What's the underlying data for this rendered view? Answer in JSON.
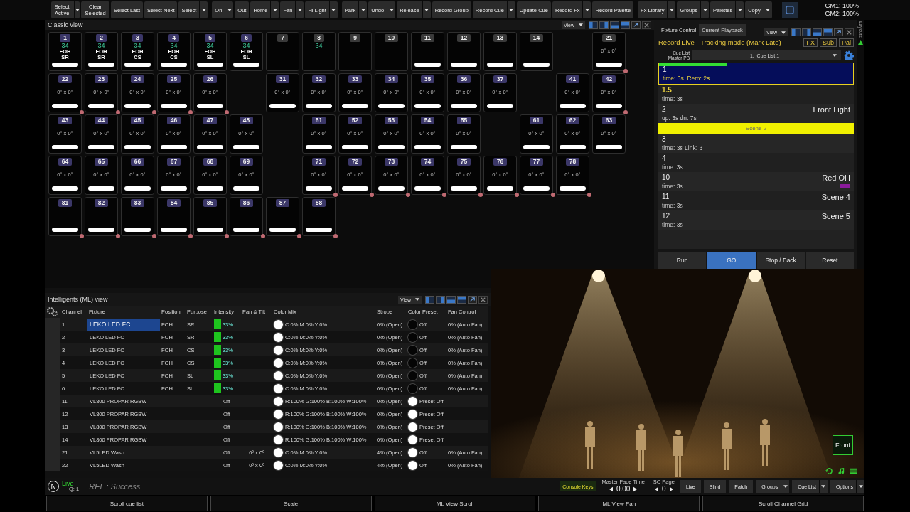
{
  "toolbar": {
    "groups": [
      [
        {
          "label": "Select Active",
          "dropdown": true,
          "wrap": true
        },
        {
          "label": "Clear Selected",
          "dropdown": false,
          "wrap": true
        },
        {
          "label": "Select Last",
          "dropdown": false,
          "wrap": false
        },
        {
          "label": "Select Next",
          "dropdown": false,
          "wrap": false
        },
        {
          "label": "Select",
          "dropdown": true,
          "wrap": false
        }
      ],
      [
        {
          "label": "On",
          "dropdown": true,
          "wrap": false
        },
        {
          "label": "Out",
          "dropdown": false,
          "wrap": false
        },
        {
          "label": "Home",
          "dropdown": true,
          "wrap": false
        },
        {
          "label": "Fan",
          "dropdown": true,
          "wrap": false
        },
        {
          "label": "Hi Light",
          "dropdown": true,
          "wrap": false
        }
      ],
      [
        {
          "label": "Park",
          "dropdown": true,
          "wrap": false
        },
        {
          "label": "Undo",
          "dropdown": true,
          "wrap": false
        },
        {
          "label": "Release",
          "dropdown": true,
          "wrap": false
        },
        {
          "label": "Record Group",
          "dropdown": false,
          "wrap": false
        },
        {
          "label": "Record Cue",
          "dropdown": true,
          "wrap": false
        },
        {
          "label": "Update Cue",
          "dropdown": false,
          "wrap": false
        },
        {
          "label": "Record Fx",
          "dropdown": true,
          "wrap": false
        },
        {
          "label": "Record Palette",
          "dropdown": false,
          "wrap": false
        }
      ],
      [
        {
          "label": "Fx Library",
          "dropdown": true,
          "wrap": false
        },
        {
          "label": "Groups",
          "dropdown": true,
          "wrap": false
        },
        {
          "label": "Palettes",
          "dropdown": true,
          "wrap": false
        },
        {
          "label": "Copy",
          "dropdown": true,
          "wrap": false
        }
      ]
    ],
    "grand_masters": [
      "GM1: 100%",
      "GM2: 100%"
    ]
  },
  "classic_view": {
    "title": "Classic view",
    "view_button": "View",
    "rows": [
      [
        {
          "kind": "channel",
          "number": "1",
          "color": "#3b3768",
          "intensity": "34",
          "position": "FOH",
          "purpose": "SR",
          "bar": true,
          "marked": false
        },
        {
          "kind": "channel",
          "number": "2",
          "color": "#3b3768",
          "intensity": "34",
          "position": "FOH",
          "purpose": "SR",
          "bar": true,
          "marked": false
        },
        {
          "kind": "channel",
          "number": "3",
          "color": "#3b3768",
          "intensity": "34",
          "position": "FOH",
          "purpose": "CS",
          "bar": true,
          "marked": false
        },
        {
          "kind": "channel",
          "number": "4",
          "color": "#3b3768",
          "intensity": "34",
          "position": "FOH",
          "purpose": "CS",
          "bar": true,
          "marked": false
        },
        {
          "kind": "channel",
          "number": "5",
          "color": "#3b3768",
          "intensity": "34",
          "position": "FOH",
          "purpose": "SL",
          "bar": true,
          "marked": false
        },
        {
          "kind": "channel",
          "number": "6",
          "color": "#3b3768",
          "intensity": "34",
          "position": "FOH",
          "purpose": "SL",
          "bar": true,
          "marked": false
        },
        {
          "kind": "channel",
          "number": "7",
          "color": "#3a3a3a",
          "bar": false,
          "marked": false
        },
        {
          "kind": "channel",
          "number": "8",
          "color": "#3a3a3a",
          "intensity": "34",
          "bar": false,
          "marked": false
        },
        {
          "kind": "channel",
          "number": "9",
          "color": "#3a3a3a",
          "bar": false,
          "marked": false
        },
        {
          "kind": "channel",
          "number": "10",
          "color": "#3a3a3a",
          "bar": false,
          "marked": false
        },
        {
          "kind": "channel",
          "number": "11",
          "color": "#3a3a3a",
          "bar": true,
          "marked": false
        },
        {
          "kind": "channel",
          "number": "12",
          "color": "#3a3a3a",
          "bar": true,
          "marked": false
        },
        {
          "kind": "channel",
          "number": "13",
          "color": "#3a3a3a",
          "bar": true,
          "marked": false
        },
        {
          "kind": "channel",
          "number": "14",
          "color": "#3a3a3a",
          "bar": true,
          "marked": false
        },
        {
          "kind": "empty"
        },
        {
          "kind": "channel",
          "number": "21",
          "color": "#3a3a3a",
          "pan_tilt": "0° x 0°",
          "bar": true,
          "marked": true
        }
      ],
      [
        {
          "kind": "channel",
          "number": "22",
          "color": "#3b3768",
          "pan_tilt": "0° x 0°",
          "bar": true,
          "marked": true
        },
        {
          "kind": "channel",
          "number": "23",
          "color": "#3b3768",
          "pan_tilt": "0° x 0°",
          "bar": true,
          "marked": true
        },
        {
          "kind": "channel",
          "number": "24",
          "color": "#3b3768",
          "pan_tilt": "0° x 0°",
          "bar": true,
          "marked": true
        },
        {
          "kind": "channel",
          "number": "25",
          "color": "#3b3768",
          "pan_tilt": "0° x 0°",
          "bar": true,
          "marked": true
        },
        {
          "kind": "channel",
          "number": "26",
          "color": "#3b3768",
          "pan_tilt": "0° x 0°",
          "bar": true,
          "marked": true
        },
        {
          "kind": "empty"
        },
        {
          "kind": "channel",
          "number": "31",
          "color": "#3b3768",
          "pan_tilt": "0° x 0°",
          "bar": true,
          "marked": false
        },
        {
          "kind": "channel",
          "number": "32",
          "color": "#3b3768",
          "pan_tilt": "0° x 0°",
          "bar": true,
          "marked": false
        },
        {
          "kind": "channel",
          "number": "33",
          "color": "#3b3768",
          "pan_tilt": "0° x 0°",
          "bar": true,
          "marked": false
        },
        {
          "kind": "channel",
          "number": "34",
          "color": "#3b3768",
          "pan_tilt": "0° x 0°",
          "bar": true,
          "marked": false
        },
        {
          "kind": "channel",
          "number": "35",
          "color": "#3b3768",
          "pan_tilt": "0° x 0°",
          "bar": true,
          "marked": false
        },
        {
          "kind": "channel",
          "number": "36",
          "color": "#3b3768",
          "pan_tilt": "0° x 0°",
          "bar": true,
          "marked": false
        },
        {
          "kind": "channel",
          "number": "37",
          "color": "#3b3768",
          "pan_tilt": "0° x 0°",
          "bar": true,
          "marked": false
        },
        {
          "kind": "empty"
        },
        {
          "kind": "channel",
          "number": "41",
          "color": "#3b3768",
          "pan_tilt": "0° x 0°",
          "bar": true,
          "marked": false
        },
        {
          "kind": "channel",
          "number": "42",
          "color": "#3b3768",
          "pan_tilt": "0° x 0°",
          "bar": true,
          "marked": true
        }
      ],
      [
        {
          "kind": "channel",
          "number": "43",
          "color": "#3b3768",
          "pan_tilt": "0° x 0°",
          "bar": true,
          "marked": false
        },
        {
          "kind": "channel",
          "number": "44",
          "color": "#3b3768",
          "pan_tilt": "0° x 0°",
          "bar": true,
          "marked": false
        },
        {
          "kind": "channel",
          "number": "45",
          "color": "#3b3768",
          "pan_tilt": "0° x 0°",
          "bar": true,
          "marked": false
        },
        {
          "kind": "channel",
          "number": "46",
          "color": "#3b3768",
          "pan_tilt": "0° x 0°",
          "bar": true,
          "marked": false
        },
        {
          "kind": "channel",
          "number": "47",
          "color": "#3b3768",
          "pan_tilt": "0° x 0°",
          "bar": true,
          "marked": false
        },
        {
          "kind": "channel",
          "number": "48",
          "color": "#3b3768",
          "pan_tilt": "0° x 0°",
          "bar": true,
          "marked": false
        },
        {
          "kind": "empty"
        },
        {
          "kind": "channel",
          "number": "51",
          "color": "#3b3768",
          "pan_tilt": "0° x 0°",
          "bar": true,
          "marked": false
        },
        {
          "kind": "channel",
          "number": "52",
          "color": "#3b3768",
          "pan_tilt": "0° x 0°",
          "bar": true,
          "marked": false
        },
        {
          "kind": "channel",
          "number": "53",
          "color": "#3b3768",
          "pan_tilt": "0° x 0°",
          "bar": true,
          "marked": false
        },
        {
          "kind": "channel",
          "number": "54",
          "color": "#3b3768",
          "pan_tilt": "0° x 0°",
          "bar": true,
          "marked": false
        },
        {
          "kind": "channel",
          "number": "55",
          "color": "#3b3768",
          "pan_tilt": "0° x 0°",
          "bar": true,
          "marked": false
        },
        {
          "kind": "empty"
        },
        {
          "kind": "channel",
          "number": "61",
          "color": "#3b3768",
          "pan_tilt": "0° x 0°",
          "bar": true,
          "marked": false
        },
        {
          "kind": "channel",
          "number": "62",
          "color": "#3b3768",
          "pan_tilt": "0° x 0°",
          "bar": true,
          "marked": false
        },
        {
          "kind": "channel",
          "number": "63",
          "color": "#3b3768",
          "pan_tilt": "0° x 0°",
          "bar": true,
          "marked": false
        }
      ],
      [
        {
          "kind": "channel",
          "number": "64",
          "color": "#3b3768",
          "pan_tilt": "0° x 0°",
          "bar": true,
          "marked": false
        },
        {
          "kind": "channel",
          "number": "65",
          "color": "#3b3768",
          "pan_tilt": "0° x 0°",
          "bar": true,
          "marked": false
        },
        {
          "kind": "channel",
          "number": "66",
          "color": "#3b3768",
          "pan_tilt": "0° x 0°",
          "bar": true,
          "marked": false
        },
        {
          "kind": "channel",
          "number": "67",
          "color": "#3b3768",
          "pan_tilt": "0° x 0°",
          "bar": true,
          "marked": false
        },
        {
          "kind": "channel",
          "number": "68",
          "color": "#3b3768",
          "pan_tilt": "0° x 0°",
          "bar": true,
          "marked": false
        },
        {
          "kind": "channel",
          "number": "69",
          "color": "#3b3768",
          "pan_tilt": "0° x 0°",
          "bar": true,
          "marked": false
        },
        {
          "kind": "empty"
        },
        {
          "kind": "channel",
          "number": "71",
          "color": "#3b3768",
          "pan_tilt": "0° x 0°",
          "bar": true,
          "marked": true
        },
        {
          "kind": "channel",
          "number": "72",
          "color": "#3b3768",
          "pan_tilt": "0° x 0°",
          "bar": true,
          "marked": true
        },
        {
          "kind": "channel",
          "number": "73",
          "color": "#3b3768",
          "pan_tilt": "0° x 0°",
          "bar": true,
          "marked": true
        },
        {
          "kind": "channel",
          "number": "74",
          "color": "#3b3768",
          "pan_tilt": "0° x 0°",
          "bar": true,
          "marked": true
        },
        {
          "kind": "channel",
          "number": "75",
          "color": "#3b3768",
          "pan_tilt": "0° x 0°",
          "bar": true,
          "marked": true
        },
        {
          "kind": "channel",
          "number": "76",
          "color": "#3b3768",
          "pan_tilt": "0° x 0°",
          "bar": true,
          "marked": true
        },
        {
          "kind": "channel",
          "number": "77",
          "color": "#3b3768",
          "pan_tilt": "0° x 0°",
          "bar": true,
          "marked": true
        },
        {
          "kind": "channel",
          "number": "78",
          "color": "#3b3768",
          "pan_tilt": "0° x 0°",
          "bar": true,
          "marked": true
        }
      ],
      [
        {
          "kind": "channel",
          "number": "81",
          "color": "#3b3768",
          "bar": true,
          "marked": true
        },
        {
          "kind": "channel",
          "number": "82",
          "color": "#3b3768",
          "bar": true,
          "marked": true
        },
        {
          "kind": "channel",
          "number": "83",
          "color": "#3b3768",
          "bar": true,
          "marked": true
        },
        {
          "kind": "channel",
          "number": "84",
          "color": "#3b3768",
          "bar": true,
          "marked": true
        },
        {
          "kind": "channel",
          "number": "85",
          "color": "#3b3768",
          "bar": true,
          "marked": true
        },
        {
          "kind": "channel",
          "number": "86",
          "color": "#3b3768",
          "bar": true,
          "marked": true
        },
        {
          "kind": "channel",
          "number": "87",
          "color": "#3b3768",
          "bar": true,
          "marked": true
        },
        {
          "kind": "channel",
          "number": "88",
          "color": "#3b3768",
          "bar": true,
          "marked": true
        }
      ]
    ]
  },
  "playback": {
    "view_button": "View",
    "side_tab": "Layouts",
    "tabs": [
      {
        "label": "Fixture Control",
        "selected": false
      },
      {
        "label": "Current Playback",
        "selected": true
      }
    ],
    "mode": "Record Live - Tracking mode (Mark Late)",
    "mode_buttons": [
      "FX",
      "Sub",
      "Pal"
    ],
    "cue_list_label": [
      "Cue List",
      "Master PB"
    ],
    "cue_list_value": "1.  Cue List 1",
    "cues": [
      {
        "kind": "cue",
        "number": "1",
        "timing": "time: 3s  Rem: 2s",
        "selected": true,
        "next": false,
        "level": 0.35
      },
      {
        "kind": "cue",
        "number": "1.5",
        "timing": "time: 3s",
        "selected": false,
        "next": true
      },
      {
        "kind": "cue",
        "number": "2",
        "timing": "up: 3s dn: 7s",
        "label": "Front Light",
        "selected": false,
        "next": false
      },
      {
        "kind": "scene",
        "label": "Scene 2"
      },
      {
        "kind": "cue",
        "number": "3",
        "timing": "time: 3s Link: 3",
        "selected": false,
        "next": false
      },
      {
        "kind": "cue",
        "number": "4",
        "timing": "time: 3s",
        "selected": false,
        "next": false
      },
      {
        "kind": "cue",
        "number": "10",
        "timing": "time: 3s",
        "label": "Red OH",
        "color": "#8a1a9a",
        "selected": false,
        "next": false
      },
      {
        "kind": "cue",
        "number": "11",
        "timing": "time: 3s",
        "label": "Scene 4",
        "selected": false,
        "next": false
      },
      {
        "kind": "cue",
        "number": "12",
        "timing": "time: 3s",
        "label": "Scene 5",
        "selected": false,
        "next": false
      }
    ],
    "buttons": [
      {
        "label": "Run",
        "selected": false
      },
      {
        "label": "GO",
        "selected": true
      },
      {
        "label": "Stop / Back",
        "selected": false
      },
      {
        "label": "Reset",
        "selected": false
      }
    ]
  },
  "ml_view": {
    "title": "Intelligents (ML) view",
    "view_button": "View",
    "columns": [
      "Channel",
      "Fixture",
      "Position",
      "Purpose",
      "Intensity",
      "Pan & Tilt",
      "Color Mix",
      "Strobe",
      "Color Preset",
      "Fan Control"
    ],
    "rows": [
      {
        "channel": "1",
        "fixture": "LEKO LED FC",
        "selected": true,
        "position": "FOH",
        "purpose": "SR",
        "intensity": "33%",
        "level": 0.33,
        "color_mix": {
          "text": "C:0% M:0% Y:0%",
          "color": "#ffffff"
        },
        "strobe": "0% (Open)",
        "color_preset": {
          "text": "Off",
          "color": "#050505"
        },
        "fan": "0% (Auto Fan)"
      },
      {
        "channel": "2",
        "fixture": "LEKO LED FC",
        "selected": false,
        "position": "FOH",
        "purpose": "SR",
        "intensity": "33%",
        "level": 0.33,
        "color_mix": {
          "text": "C:0% M:0% Y:0%",
          "color": "#ffffff"
        },
        "strobe": "0% (Open)",
        "color_preset": {
          "text": "Off",
          "color": "#050505"
        },
        "fan": "0% (Auto Fan)"
      },
      {
        "channel": "3",
        "fixture": "LEKO LED FC",
        "selected": false,
        "position": "FOH",
        "purpose": "CS",
        "intensity": "33%",
        "level": 0.33,
        "color_mix": {
          "text": "C:0% M:0% Y:0%",
          "color": "#ffffff"
        },
        "strobe": "0% (Open)",
        "color_preset": {
          "text": "Off",
          "color": "#050505"
        },
        "fan": "0% (Auto Fan)"
      },
      {
        "channel": "4",
        "fixture": "LEKO LED FC",
        "selected": false,
        "position": "FOH",
        "purpose": "CS",
        "intensity": "33%",
        "level": 0.33,
        "color_mix": {
          "text": "C:0% M:0% Y:0%",
          "color": "#ffffff"
        },
        "strobe": "0% (Open)",
        "color_preset": {
          "text": "Off",
          "color": "#050505"
        },
        "fan": "0% (Auto Fan)"
      },
      {
        "channel": "5",
        "fixture": "LEKO LED FC",
        "selected": false,
        "position": "FOH",
        "purpose": "SL",
        "intensity": "33%",
        "level": 0.33,
        "color_mix": {
          "text": "C:0% M:0% Y:0%",
          "color": "#ffffff"
        },
        "strobe": "0% (Open)",
        "color_preset": {
          "text": "Off",
          "color": "#050505"
        },
        "fan": "0% (Auto Fan)"
      },
      {
        "channel": "6",
        "fixture": "LEKO LED FC",
        "selected": false,
        "position": "FOH",
        "purpose": "SL",
        "intensity": "33%",
        "level": 0.33,
        "color_mix": {
          "text": "C:0% M:0% Y:0%",
          "color": "#ffffff"
        },
        "strobe": "0% (Open)",
        "color_preset": {
          "text": "Off",
          "color": "#050505"
        },
        "fan": "0% (Auto Fan)"
      },
      {
        "channel": "11",
        "fixture": "VL800 PROPAR RGBW",
        "selected": false,
        "intensity": "Off",
        "color_mix": {
          "text": "R:100% G:100% B:100% W:100%",
          "color": "#ffffff"
        },
        "strobe": "0% (Open)",
        "color_preset": {
          "text": "Preset Off",
          "color": "#ffffff"
        }
      },
      {
        "channel": "12",
        "fixture": "VL800 PROPAR RGBW",
        "selected": false,
        "intensity": "Off",
        "color_mix": {
          "text": "R:100% G:100% B:100% W:100%",
          "color": "#ffffff"
        },
        "strobe": "0% (Open)",
        "color_preset": {
          "text": "Preset Off",
          "color": "#ffffff"
        }
      },
      {
        "channel": "13",
        "fixture": "VL800 PROPAR RGBW",
        "selected": false,
        "intensity": "Off",
        "color_mix": {
          "text": "R:100% G:100% B:100% W:100%",
          "color": "#ffffff"
        },
        "strobe": "0% (Open)",
        "color_preset": {
          "text": "Preset Off",
          "color": "#ffffff"
        }
      },
      {
        "channel": "14",
        "fixture": "VL800 PROPAR RGBW",
        "selected": false,
        "intensity": "Off",
        "color_mix": {
          "text": "R:100% G:100% B:100% W:100%",
          "color": "#ffffff"
        },
        "strobe": "0% (Open)",
        "color_preset": {
          "text": "Preset Off",
          "color": "#ffffff"
        }
      },
      {
        "channel": "21",
        "fixture": "VL5LED Wash",
        "selected": false,
        "intensity": "Off",
        "pan_tilt": "0º x 0º",
        "color_mix": {
          "text": "C:0% M:0% Y:0%",
          "color": "#ffffff"
        },
        "strobe": "4% (Open)",
        "color_preset": {
          "text": "Off",
          "color": "#ffffff"
        },
        "fan": "0% (Auto Fan)"
      },
      {
        "channel": "22",
        "fixture": "VL5LED Wash",
        "selected": false,
        "intensity": "Off",
        "pan_tilt": "0º x 0º",
        "color_mix": {
          "text": "C:0% M:0% Y:0%",
          "color": "#ffffff"
        },
        "strobe": "4% (Open)",
        "color_preset": {
          "text": "Off",
          "color": "#ffffff"
        },
        "fan": "0% (Auto Fan)"
      }
    ]
  },
  "stage_view": {
    "kind": "picture",
    "front_button": "Front"
  },
  "status_bar": {
    "logo": "N",
    "mode": "Live",
    "queue": "Q: 1",
    "message": "REL : Success",
    "console_keys": "Console Keys",
    "fade_label": "Master Fade Time",
    "fade_value": "0.00",
    "page_label": "SC Page",
    "page_value": "0",
    "buttons": [
      {
        "label": "Live",
        "dropdown": false
      },
      {
        "label": "Blind",
        "dropdown": false
      },
      {
        "label": "Patch",
        "dropdown": false
      },
      {
        "label": "Groups",
        "dropdown": true
      },
      {
        "label": "Cue List",
        "dropdown": true
      },
      {
        "label": "Options",
        "dropdown": true
      }
    ]
  },
  "function_keys": [
    "Scroll cue list",
    "Scale",
    "ML View Scroll",
    "ML View Pan",
    "Scroll Channel Grid"
  ]
}
